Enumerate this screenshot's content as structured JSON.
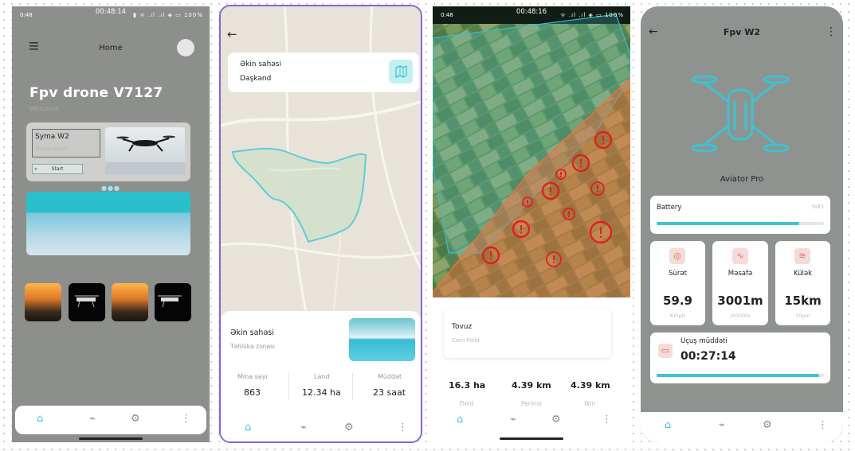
{
  "screen1": {
    "status_time_left": "0:48",
    "status_time_center": "00:48:14",
    "status_icons": "▮ ᯤ .ıl .ıl ◈ ▭ 100%",
    "header_title": "Home",
    "title": "Fpv drone V7127",
    "subtitle": "Welcome",
    "hero_name": "Syma W2",
    "hero_type": "Quadcopter",
    "start_label": "Start",
    "start_arrow": "»"
  },
  "screen2": {
    "card_title": "Əkin sahəsi",
    "card_location": "Daşkənd",
    "sheet_title": "Əkin sahəsi",
    "sheet_subtitle": "Təhlükə zonası",
    "stats": [
      {
        "label": "Mina sayı",
        "value": "863"
      },
      {
        "label": "Land",
        "value": "12.34 ha"
      },
      {
        "label": "Müddət",
        "value": "23 saat"
      }
    ]
  },
  "screen3": {
    "status_time_left": "0:48",
    "status_time_center": "00:48:16",
    "status_icons": "ᯤ .ıl .ıl ◈ ▭ 100%",
    "card_title": "Tovuz",
    "card_subtitle": "Corn Field",
    "stats": [
      {
        "label": "Field",
        "value": "16.3 ha"
      },
      {
        "label": "Perime",
        "value": "4.39 km"
      },
      {
        "label": "Win",
        "value": "4.39 km"
      }
    ]
  },
  "screen4": {
    "title": "Fpv W2",
    "drone_name": "Aviator Pro",
    "battery_label": "Battery",
    "battery_percent_text": "%85",
    "battery_level": 0.85,
    "metrics": [
      {
        "label": "Sürət",
        "value": "59.9",
        "unit": "Kmph",
        "icon": "speedometer-icon"
      },
      {
        "label": "Məsafə",
        "value": "3001m",
        "unit": "/5000m",
        "icon": "pulse-icon"
      },
      {
        "label": "Külək",
        "value": "15km",
        "unit": "10pm",
        "icon": "wind-icon"
      }
    ],
    "flight_label": "Uçuş müddəti",
    "flight_time": "00:27:14",
    "flight_progress": 0.97
  },
  "colors": {
    "accent": "#3cc3d3",
    "danger": "#e11f1f",
    "icon_bg": "#f3dcd7",
    "icon_fg": "#e36b56",
    "selection_border": "#8b62d6"
  },
  "nav_icons": [
    "home-icon",
    "activity-icon",
    "settings-icon",
    "more-vertical-icon"
  ]
}
